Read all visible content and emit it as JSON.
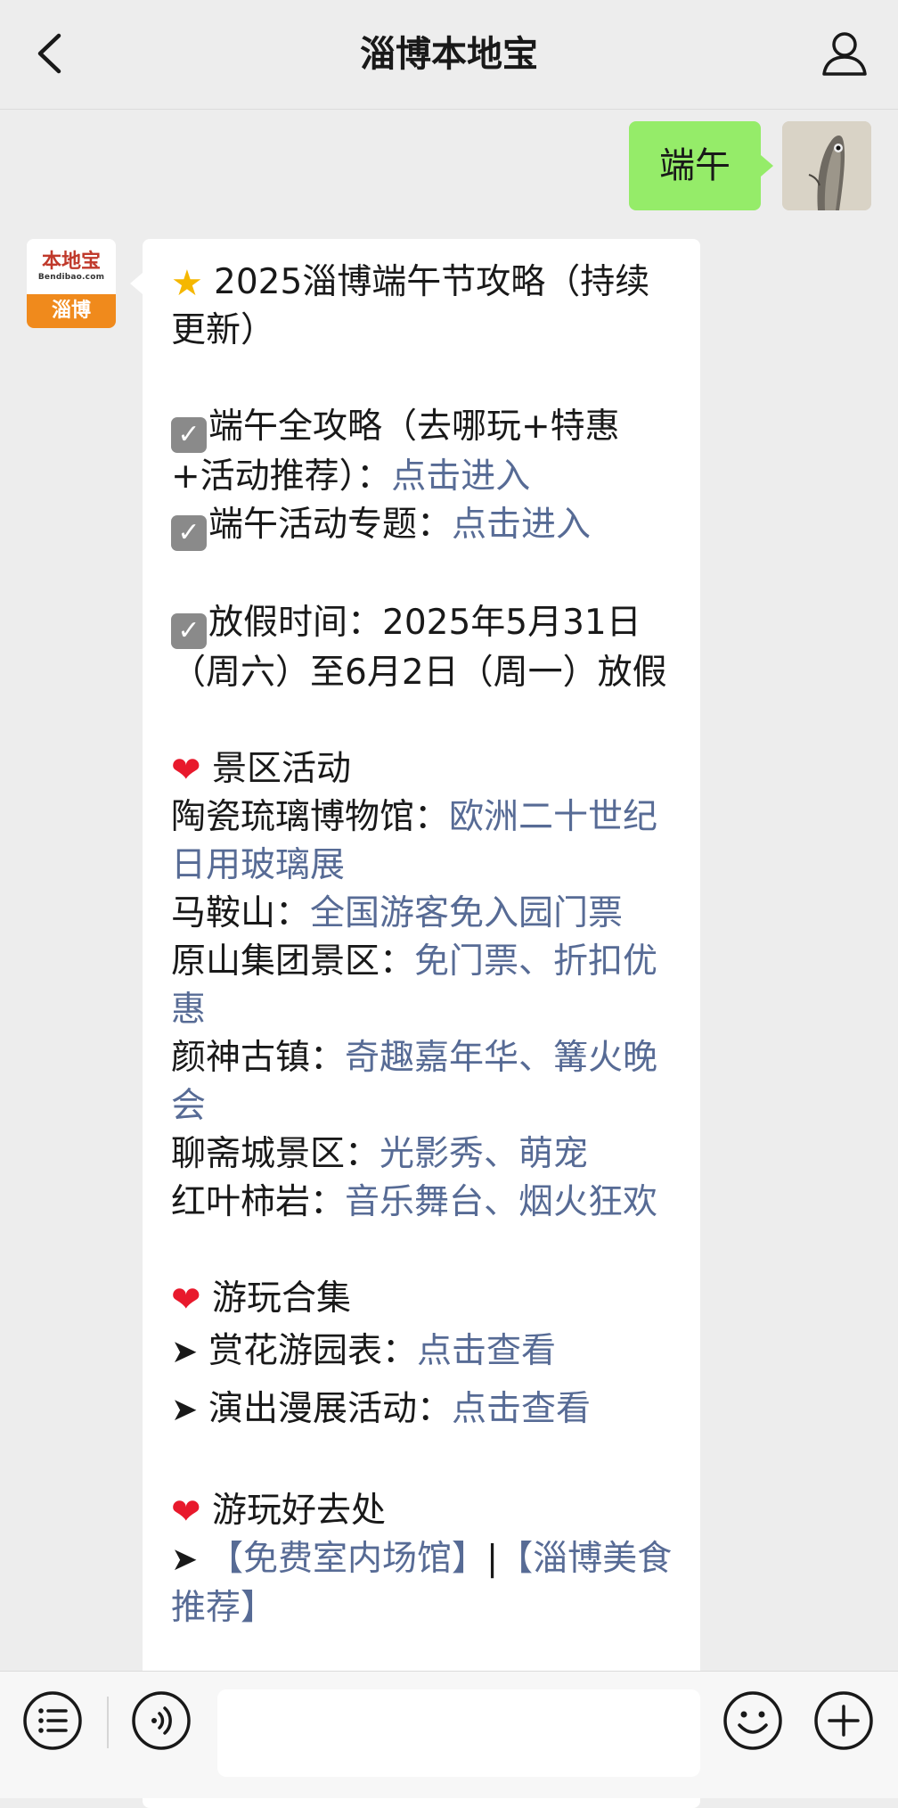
{
  "header": {
    "title": "淄博本地宝"
  },
  "sent_message": {
    "text": "端午"
  },
  "brand_avatar": {
    "logo": "本地宝",
    "sub": "Bendibao.com",
    "city": "淄博"
  },
  "received": {
    "title": "2025淄博端午节攻略（持续更新）",
    "guide_label": "端午全攻略（去哪玩+特惠+活动推荐）：",
    "guide_link": "点击进入",
    "topic_label": "端午活动专题：",
    "topic_link": "点击进入",
    "holiday_label": "放假时间：",
    "holiday_text": "2025年5月31日（周六）至6月2日（周一）放假",
    "scenic_heading": "景区活动",
    "scenic_items": [
      {
        "name": "陶瓷琉璃博物馆：",
        "detail": "欧洲二十世纪日用玻璃展"
      },
      {
        "name": "马鞍山：",
        "detail": "全国游客免入园门票"
      },
      {
        "name": "原山集团景区：",
        "detail": "免门票、折扣优惠"
      },
      {
        "name": "颜神古镇：",
        "detail": "奇趣嘉年华、篝火晚会"
      },
      {
        "name": "聊斋城景区：",
        "detail": "光影秀、萌宠"
      },
      {
        "name": "红叶柿岩：",
        "detail": "音乐舞台、烟火狂欢"
      }
    ],
    "collection_heading": "游玩合集",
    "collection_items": [
      {
        "name": "赏花游园表：",
        "detail": "点击查看"
      },
      {
        "name": "演出漫展活动：",
        "detail": "点击查看"
      }
    ],
    "places_heading": "游玩好去处",
    "places_link1": "【免费室内场馆】",
    "places_sep": "|",
    "places_link2": "【淄博美食推荐】"
  },
  "input": {
    "placeholder": ""
  },
  "icons": {
    "back": "chevron-left-icon",
    "profile": "user-icon",
    "menu": "list-menu-icon",
    "voice": "voice-icon",
    "emoji": "smiley-icon",
    "plus": "plus-icon"
  },
  "colors": {
    "sent_bubble": "#95ec69",
    "link": "#576b95",
    "brand_orange": "#f08a1c",
    "heart": "#e8192c"
  }
}
